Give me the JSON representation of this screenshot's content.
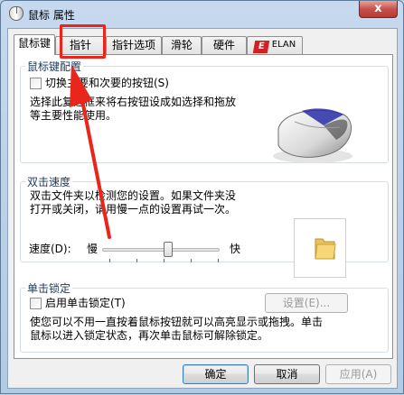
{
  "window": {
    "title": "鼠标 属性",
    "close_symbol": "x"
  },
  "tabs": [
    {
      "label": "鼠标键",
      "active": true
    },
    {
      "label": "指针",
      "active": false
    },
    {
      "label": "指针选项",
      "active": false
    },
    {
      "label": "滑轮",
      "active": false
    },
    {
      "label": "硬件",
      "active": false
    },
    {
      "label": "ELAN",
      "active": false,
      "icon": "elan-logo-icon"
    }
  ],
  "button_config": {
    "title": "鼠标键配置",
    "swap_checkbox_label": "切换主要和次要的按钮(S)",
    "swap_checked": false,
    "description_line1": "选择此复选框来将右按钮设成如选择和拖放",
    "description_line2": "等主要性能使用。"
  },
  "double_click": {
    "title": "双击速度",
    "description_line1": "双击文件夹以检测您的设置。如果文件夹没",
    "description_line2": "打开或关闭，请用慢一点的设置再试一次。",
    "speed_label": "速度(D):",
    "slow_label": "慢",
    "fast_label": "快",
    "speed_value": 0.55
  },
  "click_lock": {
    "title": "单击锁定",
    "checkbox_label": "启用单击锁定(T)",
    "checked": false,
    "settings_button": "设置(E)...",
    "description_line1": "使您可以不用一直按着鼠标按钮就可以高亮显示或拖拽。单击",
    "description_line2": "鼠标以进入锁定状态，再次单击鼠标可解除锁定。"
  },
  "footer": {
    "ok": "确定",
    "cancel": "取消",
    "apply": "应用(A)"
  },
  "colors": {
    "annotation_red": "#e8261c",
    "titlebar": "#c6d9ee",
    "close_button": "#c75050"
  }
}
